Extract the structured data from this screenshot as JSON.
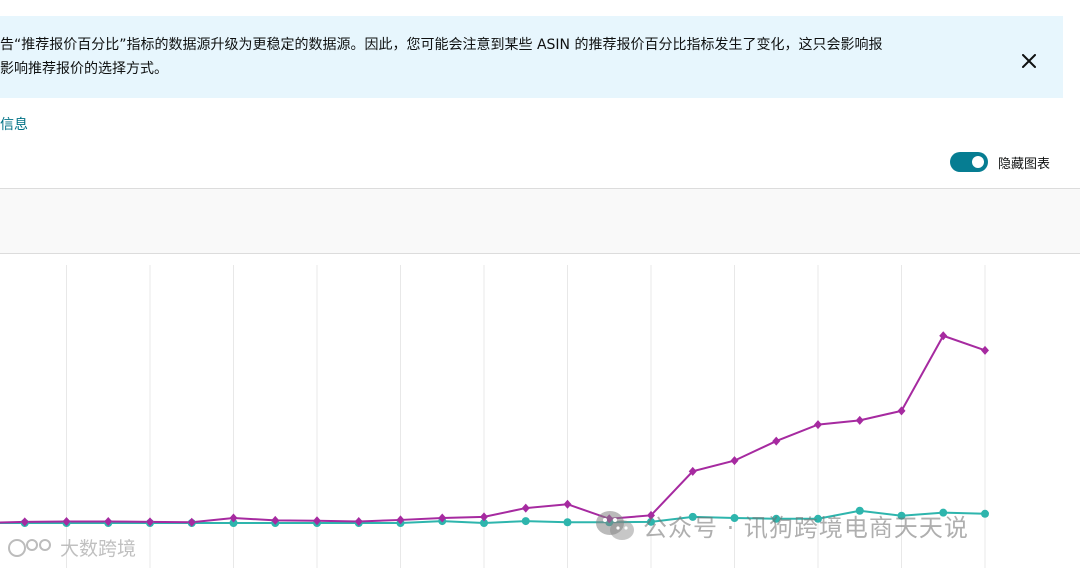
{
  "banner": {
    "line1": "告“推荐报价百分比”指标的数据源升级为更稳定的数据源。因此，您可能会注意到某些 ASIN 的推荐报价百分比指标发生了变化，这只会影响报",
    "line2": "影响推荐报价的选择方式。",
    "close_icon": "close-icon"
  },
  "more_info_link": "信息",
  "toggle": {
    "label": "隐藏图表",
    "state": "on",
    "color": "#067d92"
  },
  "watermark": {
    "text": "公众号 · 讯狗跨境电商天天说",
    "icon": "wechat-icon"
  },
  "watermark_bottom": {
    "text": "大数跨境",
    "icon": "logo-icon"
  },
  "colors": {
    "series_a": "#a62aa0",
    "series_b": "#2eb5ad",
    "grid": "#e8e8e8"
  },
  "chart_data": {
    "type": "line",
    "x": [
      1,
      2,
      3,
      4,
      5,
      6,
      7,
      8,
      9,
      10,
      11,
      12,
      13,
      14,
      15,
      16,
      17,
      18,
      19,
      20,
      21,
      22,
      23,
      24,
      25
    ],
    "series": [
      {
        "values": [
          0.0,
          0.3,
          0.4,
          0.4,
          0.3,
          0.2,
          1.3,
          0.7,
          0.6,
          0.4,
          0.8,
          1.3,
          1.6,
          3.9,
          4.9,
          1.1,
          2.0,
          13.5,
          16.3,
          21.4,
          25.7,
          26.8,
          29.3,
          48.9,
          45.1
        ]
      },
      {
        "values": [
          0.0,
          0.0,
          0.0,
          0.0,
          0.0,
          0.0,
          0.0,
          0.0,
          0.0,
          0.0,
          0.0,
          0.5,
          0.0,
          0.5,
          0.2,
          0.2,
          0.3,
          1.6,
          1.3,
          1.1,
          1.1,
          3.2,
          1.9,
          2.7,
          2.4
        ]
      }
    ],
    "ylim": [
      0,
      70
    ],
    "grid": true
  }
}
